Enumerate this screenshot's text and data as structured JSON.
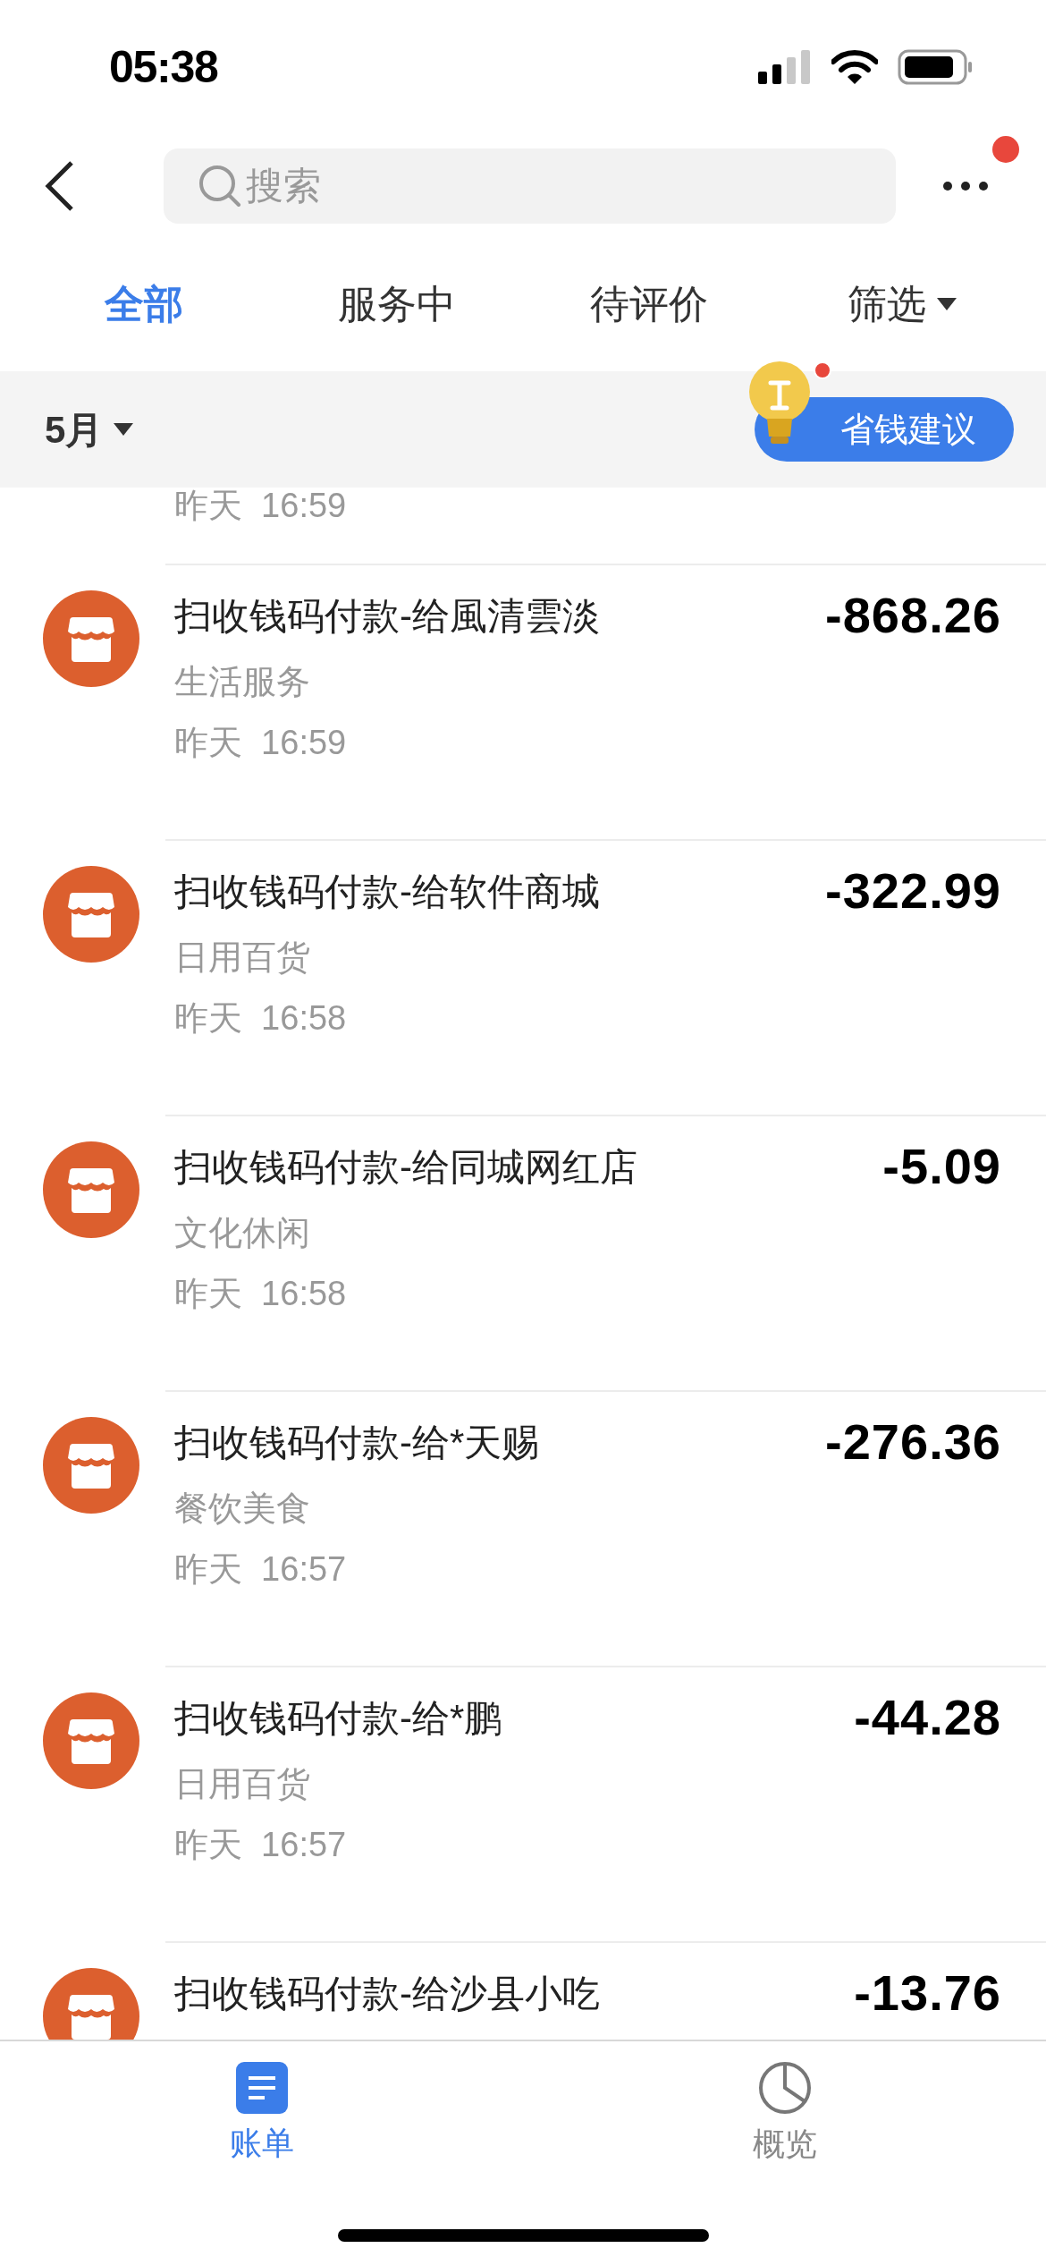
{
  "status_bar": {
    "time": "05:38"
  },
  "nav": {
    "search": {
      "placeholder": "搜索"
    },
    "more_badge": true
  },
  "tabs": [
    {
      "label": "全部",
      "selected": true,
      "kind": "tab"
    },
    {
      "label": "服务中",
      "selected": false,
      "kind": "tab"
    },
    {
      "label": "待评价",
      "selected": false,
      "kind": "tab"
    },
    {
      "label": "筛选",
      "selected": false,
      "kind": "dropdown"
    }
  ],
  "month_bar": {
    "month": "5月",
    "tip_button": {
      "label": "省钱建议",
      "badge": true
    }
  },
  "transactions": [
    {
      "kind": "cut_top",
      "time": "昨天  16:59"
    },
    {
      "kind": "full",
      "title": "扫收钱码付款-给風清雲淡",
      "amount": "-868.26",
      "category": "生活服务",
      "time": "昨天  16:59"
    },
    {
      "kind": "full",
      "title": "扫收钱码付款-给软件商城",
      "amount": "-322.99",
      "category": "日用百货",
      "time": "昨天  16:58"
    },
    {
      "kind": "full",
      "title": "扫收钱码付款-给同城网红店",
      "amount": "-5.09",
      "category": "文化休闲",
      "time": "昨天  16:58"
    },
    {
      "kind": "full",
      "title": "扫收钱码付款-给*天赐",
      "amount": "-276.36",
      "category": "餐饮美食",
      "time": "昨天  16:57"
    },
    {
      "kind": "full",
      "title": "扫收钱码付款-给*鹏",
      "amount": "-44.28",
      "category": "日用百货",
      "time": "昨天  16:57"
    },
    {
      "kind": "cut_bottom",
      "title": "扫收钱码付款-给沙县小吃",
      "amount": "-13.76"
    }
  ],
  "bottom_tabs": [
    {
      "label": "账单",
      "selected": true,
      "kind": "bill"
    },
    {
      "label": "概览",
      "selected": false,
      "kind": "overview"
    }
  ]
}
